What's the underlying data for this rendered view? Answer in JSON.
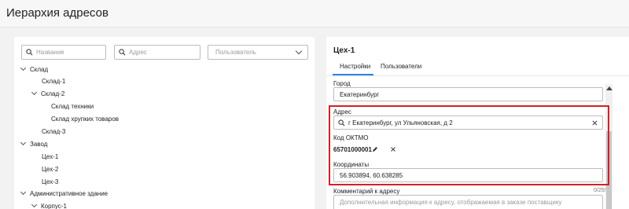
{
  "page": {
    "title": "Иерархия адресов"
  },
  "filters": {
    "name_placeholder": "Название",
    "address_placeholder": "Адрес",
    "user_placeholder": "Пользователь"
  },
  "tree": [
    {
      "label": "Склад",
      "expanded": true
    },
    {
      "label": "Склад-1"
    },
    {
      "label": "Склад-2",
      "expanded": true
    },
    {
      "label": "Склад техники"
    },
    {
      "label": "Склад хрупких товаров"
    },
    {
      "label": "Склад-3"
    },
    {
      "label": "Завод",
      "expanded": true
    },
    {
      "label": "Цех-1"
    },
    {
      "label": "Цех-2"
    },
    {
      "label": "Цех-3"
    },
    {
      "label": "Административное здание",
      "expanded": true
    },
    {
      "label": "Корпус-1",
      "expanded": true
    }
  ],
  "details": {
    "title": "Цех-1",
    "tabs": [
      "Настройки",
      "Пользователи"
    ],
    "active_tab": "Настройки",
    "city_label": "Город",
    "city_value": "Екатеринбург",
    "address_label": "Адрес",
    "address_value": "г Екатеринбург, ул Ульяновская, д 2",
    "oktmo_label": "Код ОКТМО",
    "oktmo_value": "65701000001",
    "coordinates_label": "Координаты",
    "coordinates_value": "56.903894, 60.638285",
    "comment_label": "Комментарий к адресу",
    "comment_counter": "0/255",
    "comment_placeholder": "Дополнительная информация к адресу, отображаемая в заказе поставщику"
  },
  "colors": {
    "accent": "#2f80ed",
    "highlight": "#d32027"
  }
}
